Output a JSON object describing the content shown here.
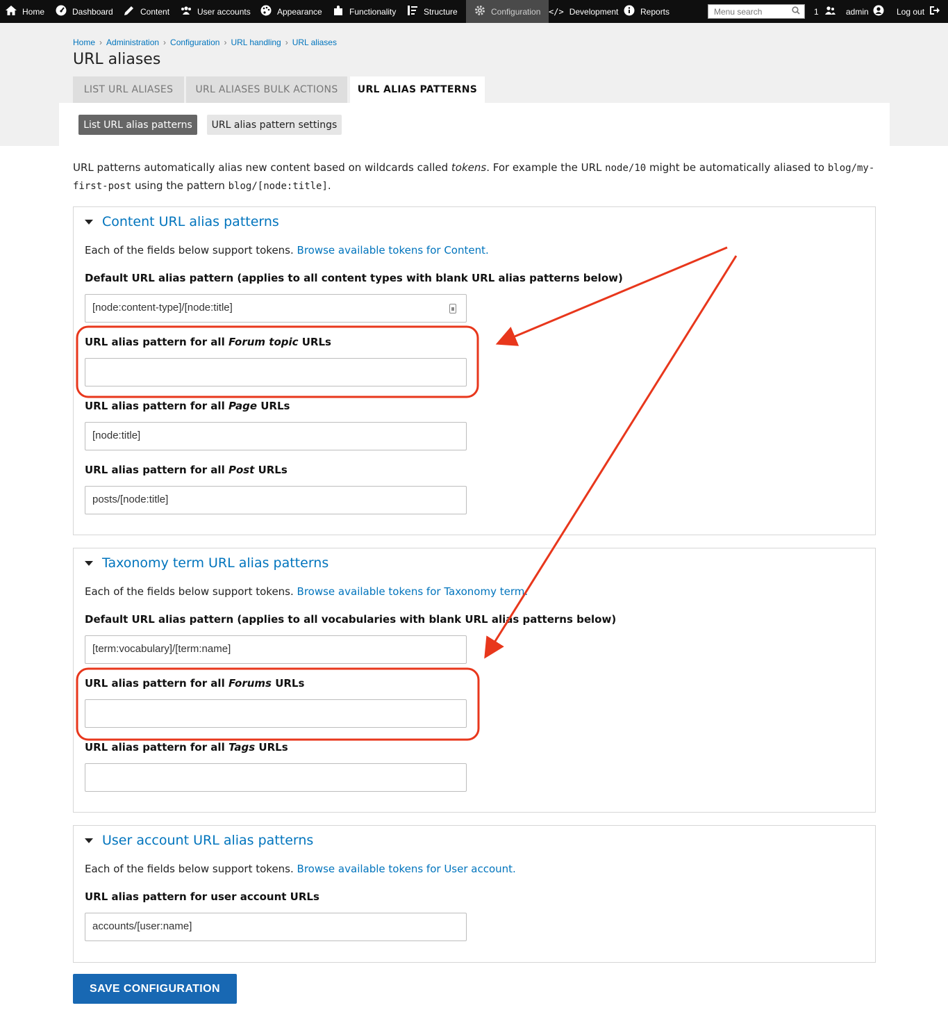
{
  "toolbar": {
    "items": [
      {
        "label": "Home",
        "icon": "home-icon"
      },
      {
        "label": "Dashboard",
        "icon": "dashboard-icon"
      },
      {
        "label": "Content",
        "icon": "pencil-icon"
      },
      {
        "label": "User accounts",
        "icon": "users-icon"
      },
      {
        "label": "Appearance",
        "icon": "palette-icon"
      },
      {
        "label": "Functionality",
        "icon": "puzzle-icon"
      },
      {
        "label": "Structure",
        "icon": "structure-icon"
      },
      {
        "label": "Configuration",
        "icon": "gear-icon",
        "active": true
      },
      {
        "label": "Development",
        "icon": "code-icon"
      },
      {
        "label": "Reports",
        "icon": "info-icon"
      }
    ],
    "search_placeholder": "Menu search",
    "user_count": "1",
    "username": "admin",
    "logout": "Log out"
  },
  "breadcrumb": [
    "Home",
    "Administration",
    "Configuration",
    "URL handling",
    "URL aliases"
  ],
  "page_title": "URL aliases",
  "tabs": [
    "LIST URL ALIASES",
    "URL ALIASES BULK ACTIONS",
    "URL ALIAS PATTERNS"
  ],
  "subtabs": [
    "List URL alias patterns",
    "URL alias pattern settings"
  ],
  "intro": {
    "text1": "URL patterns automatically alias new content based on wildcards called ",
    "em": "tokens",
    "text2": ". For example the URL ",
    "code1": "node/10",
    "text3": " might be automatically aliased to ",
    "code2a": "blog/my-",
    "code2b": "first-post",
    "text4": " using the pattern ",
    "code3": "blog/[node:title]",
    "text5": "."
  },
  "content_section": {
    "legend": "Content URL alias patterns",
    "help_text": "Each of the fields below support tokens. ",
    "help_link": "Browse available tokens for Content.",
    "default_label": "Default URL alias pattern (applies to all content types with blank URL alias patterns below)",
    "default_value": "[node:content-type]/[node:title]",
    "label_prefix": "URL alias pattern for all ",
    "label_suffix": " URLs",
    "forum_topic_type": "Forum topic",
    "forum_topic_value": "",
    "page_type": "Page",
    "page_value": "[node:title]",
    "post_type": "Post",
    "post_value": "posts/[node:title]"
  },
  "taxonomy_section": {
    "legend": "Taxonomy term URL alias patterns",
    "help_text": "Each of the fields below support tokens. ",
    "help_link": "Browse available tokens for Taxonomy term.",
    "default_label": "Default URL alias pattern (applies to all vocabularies with blank URL alias patterns below)",
    "default_value": "[term:vocabulary]/[term:name]",
    "label_prefix": "URL alias pattern for all ",
    "label_suffix": " URLs",
    "forums_type": "Forums",
    "forums_value": "",
    "tags_type": "Tags",
    "tags_value": ""
  },
  "user_section": {
    "legend": "User account URL alias patterns",
    "help_text": "Each of the fields below support tokens. ",
    "help_link": "Browse available tokens for User account.",
    "field_label": "URL alias pattern for user account URLs",
    "field_value": "accounts/[user:name]"
  },
  "save_button": "SAVE CONFIGURATION",
  "colors": {
    "link": "#0074bd",
    "primary_button": "#1868b3",
    "annotation": "#e8371c",
    "toolbar_bg": "#0f0f0f"
  }
}
